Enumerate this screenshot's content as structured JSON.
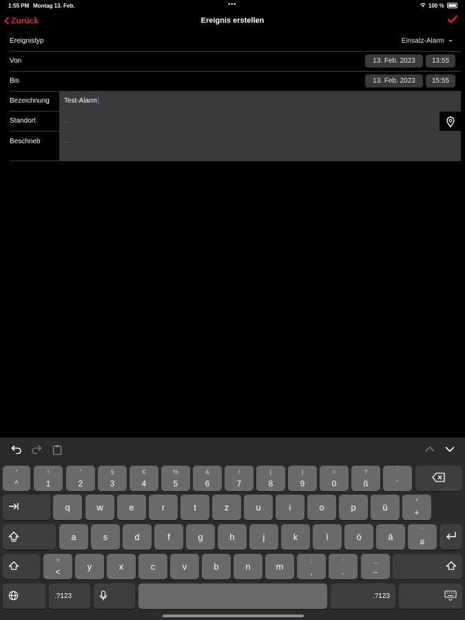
{
  "status": {
    "time": "1:55 PM",
    "date": "Montag 13. Feb.",
    "battery": "100 %"
  },
  "nav": {
    "back_label": "Zurück",
    "title": "Ereignis erstellen"
  },
  "form": {
    "type": {
      "label": "Ereignistyp",
      "value": "Einsatz-Alarm"
    },
    "from": {
      "label": "Von",
      "date": "13. Feb. 2023",
      "time": "13:55"
    },
    "to": {
      "label": "Bis",
      "date": "13. Feb. 2023",
      "time": "15:55"
    },
    "name": {
      "label": "Bezeichnung",
      "value": "Test-Alarm"
    },
    "location": {
      "label": "Standort",
      "placeholder": "..."
    },
    "description": {
      "label": "Beschrieb",
      "placeholder": "..."
    }
  },
  "keyboard": {
    "row1": [
      {
        "top": "°",
        "bot": "^"
      },
      {
        "top": "!",
        "bot": "1"
      },
      {
        "top": "\"",
        "bot": "2"
      },
      {
        "top": "§",
        "bot": "3"
      },
      {
        "top": "€",
        "bot": "4"
      },
      {
        "top": "%",
        "bot": "5"
      },
      {
        "top": "&",
        "bot": "6"
      },
      {
        "top": "/",
        "bot": "7"
      },
      {
        "top": "(",
        "bot": "8"
      },
      {
        "top": ")",
        "bot": "9"
      },
      {
        "top": "=",
        "bot": "0"
      },
      {
        "top": "?",
        "bot": "ß"
      },
      {
        "top": "`",
        "bot": "´"
      }
    ],
    "row2": [
      "q",
      "w",
      "e",
      "r",
      "t",
      "z",
      "u",
      "i",
      "o",
      "p",
      "ü"
    ],
    "row2_last": {
      "top": "*",
      "bot": "+"
    },
    "row3": [
      "a",
      "s",
      "d",
      "f",
      "g",
      "h",
      "j",
      "k",
      "l",
      "ö",
      "ä"
    ],
    "row3_last": {
      "top": "'",
      "bot": "#"
    },
    "row4_first": {
      "top": ">",
      "bot": "<"
    },
    "row4": [
      "y",
      "x",
      "c",
      "v",
      "b",
      "n",
      "m"
    ],
    "row4_punct": [
      {
        "top": ";",
        "bot": ","
      },
      {
        "top": ":",
        "bot": "."
      },
      {
        "top": "_",
        "bot": "–"
      }
    ],
    "num_label": ".?123"
  }
}
